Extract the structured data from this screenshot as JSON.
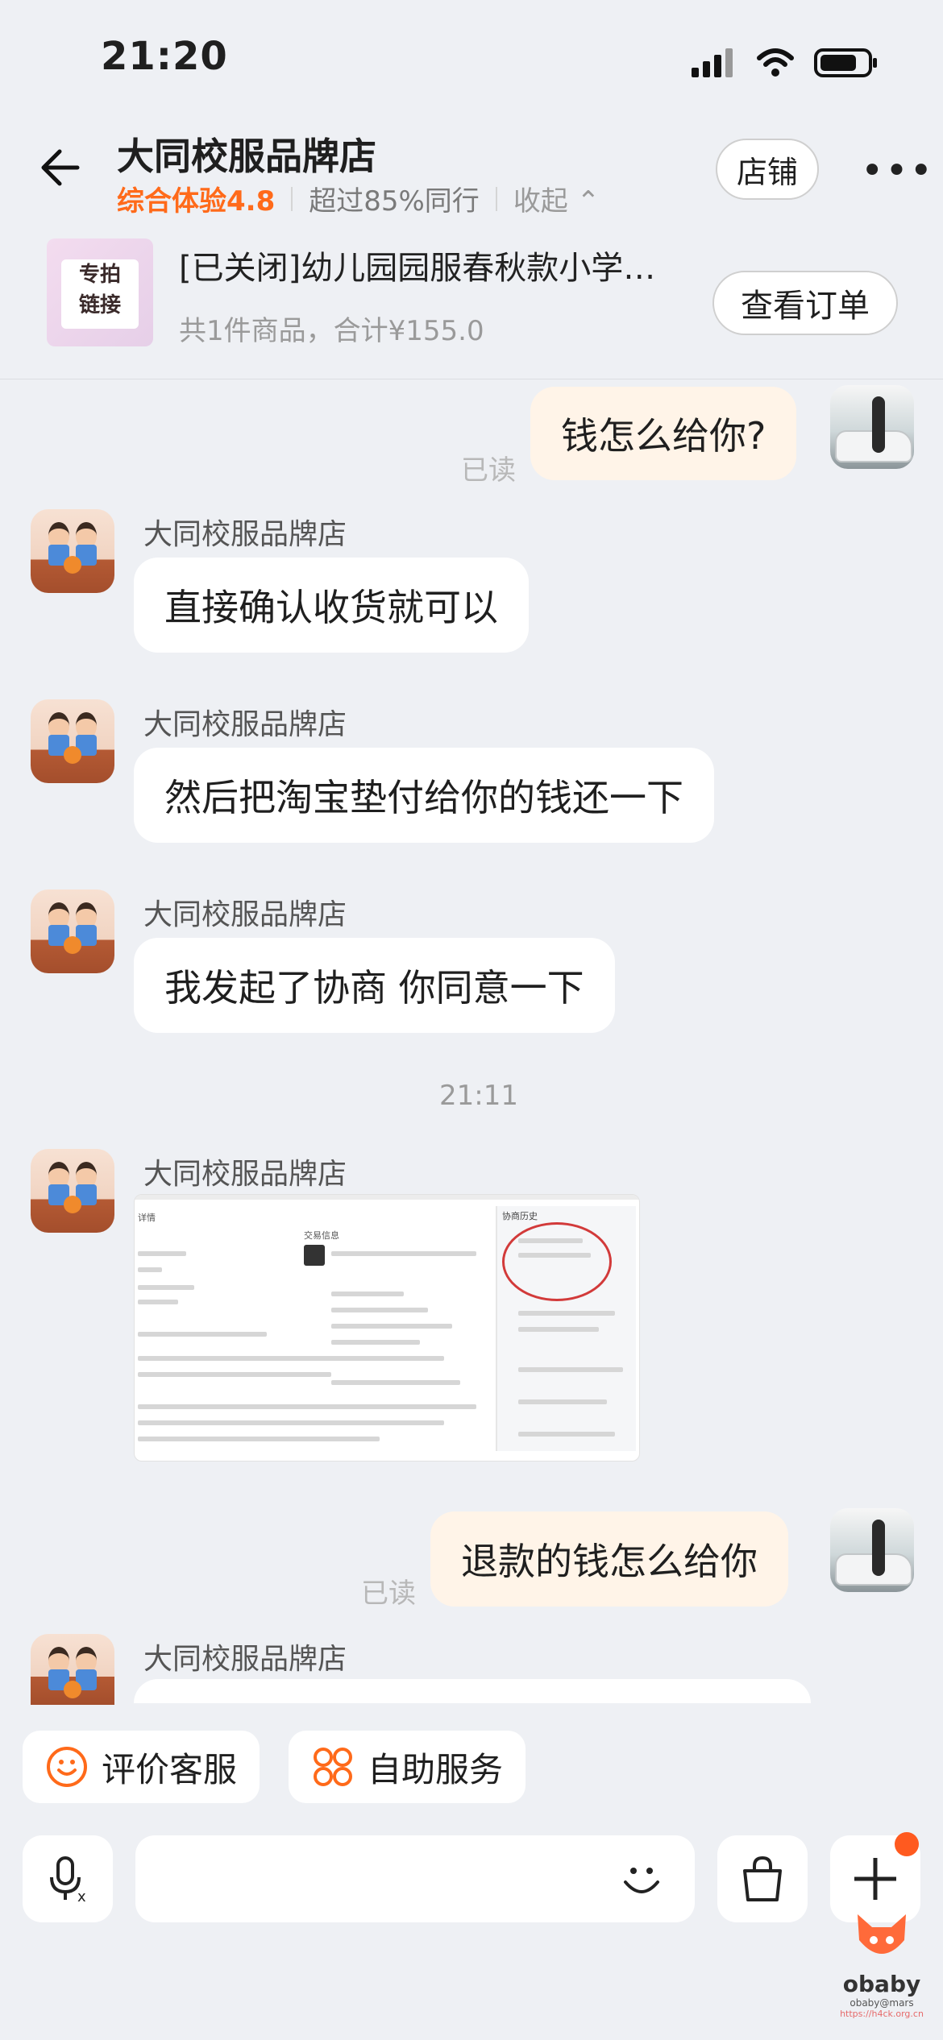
{
  "status_bar": {
    "time": "21:20"
  },
  "header": {
    "shop_name": "大同校服品牌店",
    "rating_label": "综合体验4.8",
    "beats_label": "超过85%同行",
    "collapse_label": "收起",
    "store_button": "店铺"
  },
  "order": {
    "thumb_text_line1": "专拍",
    "thumb_text_line2": "链接",
    "title": "[已关闭]幼儿园园服春秋款小学…",
    "subtitle": "共1件商品，合计¥155.0",
    "view_button": "查看订单"
  },
  "chat": {
    "messages": [
      {
        "text": "钱怎么给你?",
        "read": "已读"
      },
      {
        "sender": "大同校服品牌店",
        "text": "直接确认收货就可以"
      },
      {
        "sender": "大同校服品牌店",
        "text": "然后把淘宝垫付给你的钱还一下"
      },
      {
        "sender": "大同校服品牌店",
        "text": "我发起了协商 你同意一下"
      },
      {
        "timestamp": "21:11"
      },
      {
        "sender": "大同校服品牌店",
        "image_header_left": "详情",
        "image_header_mid": "交易信息",
        "image_header_right": "协商历史"
      },
      {
        "text": "退款的钱怎么给你",
        "read": "已读"
      },
      {
        "sender": "大同校服品牌店"
      }
    ]
  },
  "quick_actions": {
    "rate_service": "评价客服",
    "self_service": "自助服务"
  },
  "watermark": {
    "brand": "obaby",
    "sub": "obaby@mars",
    "url": "https://h4ck.org.cn"
  },
  "colors": {
    "accent": "#ff6a1a",
    "background": "#eef0f4",
    "my_bubble": "#fff4e8"
  },
  "icons": [
    "back-arrow-icon",
    "more-dots-icon",
    "smile-icon",
    "grid-icon",
    "voice-icon",
    "emoji-icon",
    "bag-icon",
    "plus-icon"
  ]
}
